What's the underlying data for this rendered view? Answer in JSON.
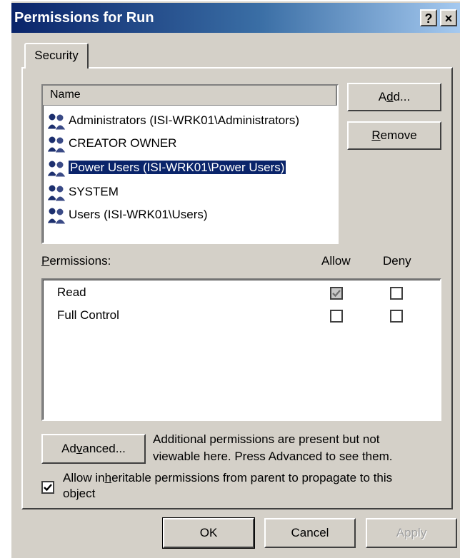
{
  "window": {
    "title": "Permissions for Run",
    "help_button": "?",
    "close_button": "×"
  },
  "tabs": [
    {
      "label": "Security"
    }
  ],
  "names_list": {
    "header": "Name",
    "items": [
      {
        "label": "Administrators (ISI-WRK01\\Administrators)",
        "selected": false
      },
      {
        "label": "CREATOR OWNER",
        "selected": false
      },
      {
        "label": "Power Users (ISI-WRK01\\Power Users)",
        "selected": true
      },
      {
        "label": "SYSTEM",
        "selected": false
      },
      {
        "label": "Users (ISI-WRK01\\Users)",
        "selected": false
      }
    ]
  },
  "buttons": {
    "add": {
      "prefix": "A",
      "mnemonic": "d",
      "suffix": "d..."
    },
    "remove": {
      "prefix": "",
      "mnemonic": "R",
      "suffix": "emove"
    },
    "advanced": {
      "prefix": "Ad",
      "mnemonic": "v",
      "suffix": "anced..."
    },
    "ok": "OK",
    "cancel": "Cancel",
    "apply": "Apply"
  },
  "permissions": {
    "label_mnemonic": "P",
    "label_rest": "ermissions:",
    "allow_header": "Allow",
    "deny_header": "Deny",
    "rows": [
      {
        "name": "Read",
        "allow": "checked-grey",
        "deny": "unchecked"
      },
      {
        "name": "Full Control",
        "allow": "unchecked",
        "deny": "unchecked"
      }
    ]
  },
  "advanced_note": {
    "line1": "Additional permissions are present but not",
    "line2": "viewable here. Press Advanced to see them."
  },
  "inherit": {
    "checked": true,
    "line1_prefix": "Allow in",
    "line1_mnemonic": "h",
    "line1_suffix": "eritable permissions from parent to propagate to this",
    "line2": "object"
  },
  "colors": {
    "dialog_face": "#d4d0c8",
    "title_active_start": "#0a246a",
    "title_active_end": "#a6caf0",
    "selection": "#0a246a"
  },
  "icons": {
    "group": "users-group-icon"
  }
}
